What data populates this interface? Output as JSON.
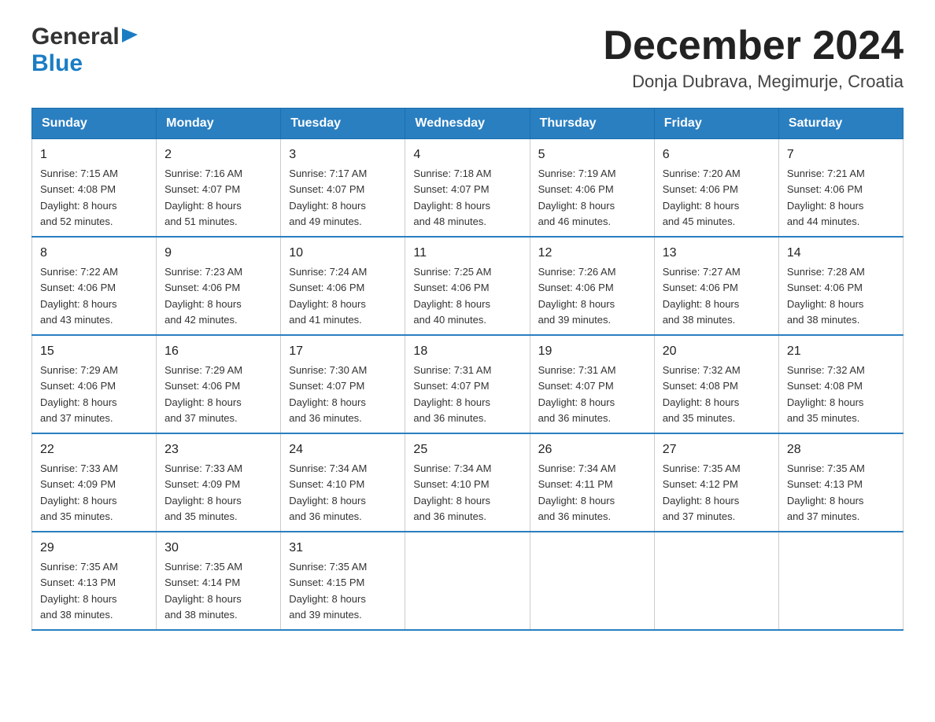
{
  "header": {
    "title": "December 2024",
    "subtitle": "Donja Dubrava, Megimurje, Croatia",
    "logo_general": "General",
    "logo_blue": "Blue"
  },
  "weekdays": [
    "Sunday",
    "Monday",
    "Tuesday",
    "Wednesday",
    "Thursday",
    "Friday",
    "Saturday"
  ],
  "weeks": [
    [
      {
        "day": "1",
        "sunrise": "7:15 AM",
        "sunset": "4:08 PM",
        "daylight": "8 hours and 52 minutes."
      },
      {
        "day": "2",
        "sunrise": "7:16 AM",
        "sunset": "4:07 PM",
        "daylight": "8 hours and 51 minutes."
      },
      {
        "day": "3",
        "sunrise": "7:17 AM",
        "sunset": "4:07 PM",
        "daylight": "8 hours and 49 minutes."
      },
      {
        "day": "4",
        "sunrise": "7:18 AM",
        "sunset": "4:07 PM",
        "daylight": "8 hours and 48 minutes."
      },
      {
        "day": "5",
        "sunrise": "7:19 AM",
        "sunset": "4:06 PM",
        "daylight": "8 hours and 46 minutes."
      },
      {
        "day": "6",
        "sunrise": "7:20 AM",
        "sunset": "4:06 PM",
        "daylight": "8 hours and 45 minutes."
      },
      {
        "day": "7",
        "sunrise": "7:21 AM",
        "sunset": "4:06 PM",
        "daylight": "8 hours and 44 minutes."
      }
    ],
    [
      {
        "day": "8",
        "sunrise": "7:22 AM",
        "sunset": "4:06 PM",
        "daylight": "8 hours and 43 minutes."
      },
      {
        "day": "9",
        "sunrise": "7:23 AM",
        "sunset": "4:06 PM",
        "daylight": "8 hours and 42 minutes."
      },
      {
        "day": "10",
        "sunrise": "7:24 AM",
        "sunset": "4:06 PM",
        "daylight": "8 hours and 41 minutes."
      },
      {
        "day": "11",
        "sunrise": "7:25 AM",
        "sunset": "4:06 PM",
        "daylight": "8 hours and 40 minutes."
      },
      {
        "day": "12",
        "sunrise": "7:26 AM",
        "sunset": "4:06 PM",
        "daylight": "8 hours and 39 minutes."
      },
      {
        "day": "13",
        "sunrise": "7:27 AM",
        "sunset": "4:06 PM",
        "daylight": "8 hours and 38 minutes."
      },
      {
        "day": "14",
        "sunrise": "7:28 AM",
        "sunset": "4:06 PM",
        "daylight": "8 hours and 38 minutes."
      }
    ],
    [
      {
        "day": "15",
        "sunrise": "7:29 AM",
        "sunset": "4:06 PM",
        "daylight": "8 hours and 37 minutes."
      },
      {
        "day": "16",
        "sunrise": "7:29 AM",
        "sunset": "4:06 PM",
        "daylight": "8 hours and 37 minutes."
      },
      {
        "day": "17",
        "sunrise": "7:30 AM",
        "sunset": "4:07 PM",
        "daylight": "8 hours and 36 minutes."
      },
      {
        "day": "18",
        "sunrise": "7:31 AM",
        "sunset": "4:07 PM",
        "daylight": "8 hours and 36 minutes."
      },
      {
        "day": "19",
        "sunrise": "7:31 AM",
        "sunset": "4:07 PM",
        "daylight": "8 hours and 36 minutes."
      },
      {
        "day": "20",
        "sunrise": "7:32 AM",
        "sunset": "4:08 PM",
        "daylight": "8 hours and 35 minutes."
      },
      {
        "day": "21",
        "sunrise": "7:32 AM",
        "sunset": "4:08 PM",
        "daylight": "8 hours and 35 minutes."
      }
    ],
    [
      {
        "day": "22",
        "sunrise": "7:33 AM",
        "sunset": "4:09 PM",
        "daylight": "8 hours and 35 minutes."
      },
      {
        "day": "23",
        "sunrise": "7:33 AM",
        "sunset": "4:09 PM",
        "daylight": "8 hours and 35 minutes."
      },
      {
        "day": "24",
        "sunrise": "7:34 AM",
        "sunset": "4:10 PM",
        "daylight": "8 hours and 36 minutes."
      },
      {
        "day": "25",
        "sunrise": "7:34 AM",
        "sunset": "4:10 PM",
        "daylight": "8 hours and 36 minutes."
      },
      {
        "day": "26",
        "sunrise": "7:34 AM",
        "sunset": "4:11 PM",
        "daylight": "8 hours and 36 minutes."
      },
      {
        "day": "27",
        "sunrise": "7:35 AM",
        "sunset": "4:12 PM",
        "daylight": "8 hours and 37 minutes."
      },
      {
        "day": "28",
        "sunrise": "7:35 AM",
        "sunset": "4:13 PM",
        "daylight": "8 hours and 37 minutes."
      }
    ],
    [
      {
        "day": "29",
        "sunrise": "7:35 AM",
        "sunset": "4:13 PM",
        "daylight": "8 hours and 38 minutes."
      },
      {
        "day": "30",
        "sunrise": "7:35 AM",
        "sunset": "4:14 PM",
        "daylight": "8 hours and 38 minutes."
      },
      {
        "day": "31",
        "sunrise": "7:35 AM",
        "sunset": "4:15 PM",
        "daylight": "8 hours and 39 minutes."
      },
      null,
      null,
      null,
      null
    ]
  ],
  "labels": {
    "sunrise": "Sunrise:",
    "sunset": "Sunset:",
    "daylight": "Daylight:"
  }
}
